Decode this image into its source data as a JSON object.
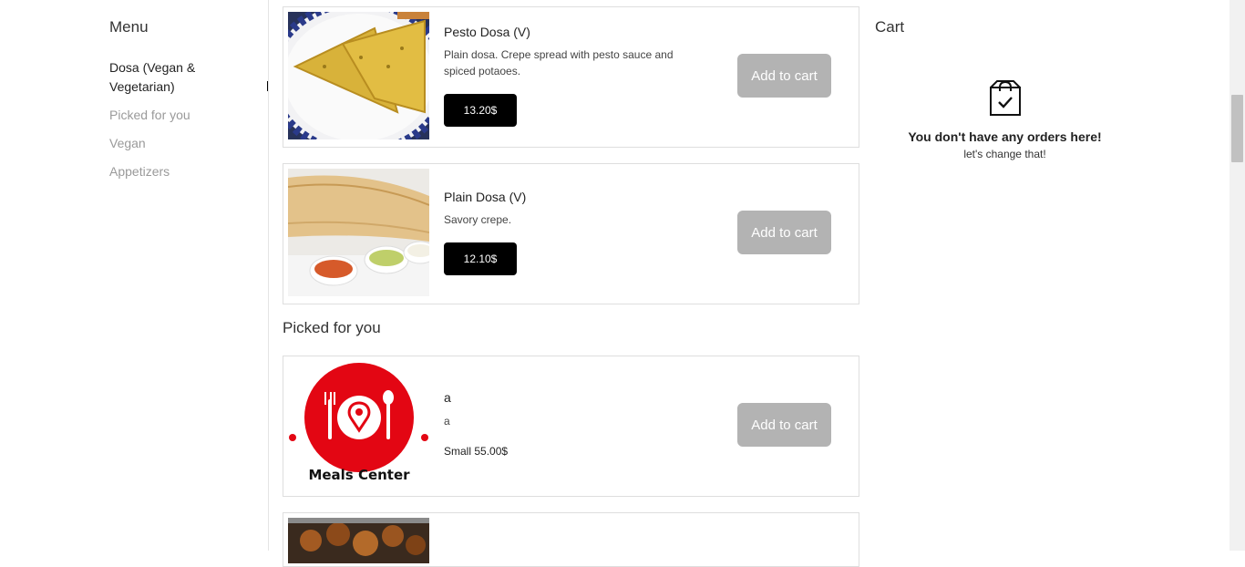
{
  "menu": {
    "title": "Menu",
    "items": [
      {
        "label": "Dosa (Vegan & Vegetarian)"
      },
      {
        "label": "Picked for you"
      },
      {
        "label": "Vegan"
      },
      {
        "label": "Appetizers"
      }
    ]
  },
  "products": [
    {
      "name": "Pesto Dosa (V)",
      "description": "Plain dosa. Crepe spread with pesto sauce and spiced potaoes.",
      "price": "13.20$",
      "add_label": "Add to cart"
    },
    {
      "name": "Plain Dosa (V)",
      "description": "Savory crepe.",
      "price": "12.10$",
      "add_label": "Add to cart"
    }
  ],
  "picked": {
    "title": "Picked for you",
    "items": [
      {
        "name": "a",
        "description": "a",
        "price": "Small 55.00$",
        "add_label": "Add to cart",
        "logo_text": "Meals Center"
      }
    ]
  },
  "cart": {
    "title": "Cart",
    "empty_title": "You don't have any orders here!",
    "empty_subtitle": "let's change that!"
  },
  "colors": {
    "price_bg": "#000000",
    "add_btn_bg": "#b3b3b3",
    "logo_red": "#e30613"
  },
  "icons": {
    "cart": "shopping-bag-check-icon"
  }
}
